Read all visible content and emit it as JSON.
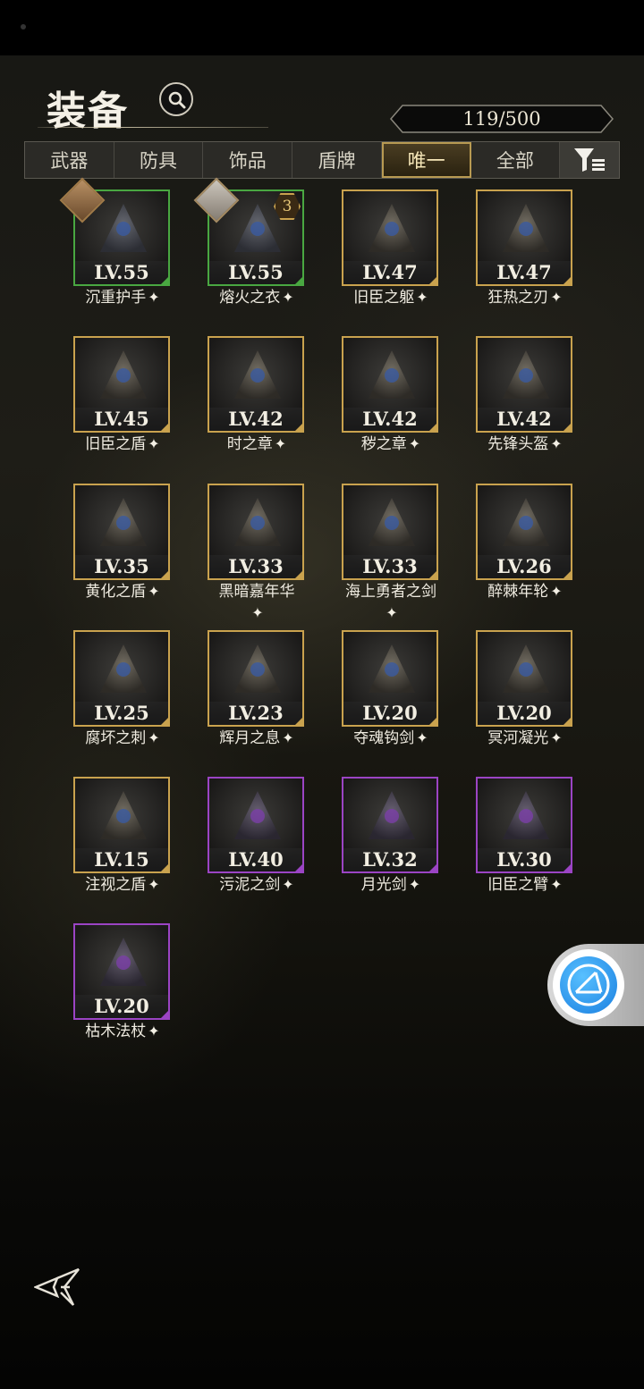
{
  "header": {
    "title": "装备",
    "count": "119/500"
  },
  "tabs": [
    {
      "label": "武器",
      "active": false
    },
    {
      "label": "防具",
      "active": false
    },
    {
      "label": "饰品",
      "active": false
    },
    {
      "label": "盾牌",
      "active": false
    },
    {
      "label": "唯一",
      "active": true
    },
    {
      "label": "全部",
      "active": false
    }
  ],
  "items": [
    {
      "level": "LV.55",
      "name": "沉重护手",
      "rarity": "green",
      "icon": "gauntlet-icon"
    },
    {
      "level": "LV.55",
      "name": "熔火之衣",
      "rarity": "green",
      "icon": "molten-armor-icon",
      "badge": "3"
    },
    {
      "level": "LV.47",
      "name": "旧臣之躯",
      "rarity": "gold",
      "icon": "plate-armor-icon"
    },
    {
      "level": "LV.47",
      "name": "狂热之刃",
      "rarity": "gold",
      "icon": "sword-icon"
    },
    {
      "level": "LV.45",
      "name": "旧臣之盾",
      "rarity": "gold",
      "icon": "tower-shield-icon"
    },
    {
      "level": "LV.42",
      "name": "时之章",
      "rarity": "gold",
      "icon": "tome-icon"
    },
    {
      "level": "LV.42",
      "name": "秽之章",
      "rarity": "gold",
      "icon": "dark-tome-icon"
    },
    {
      "level": "LV.42",
      "name": "先锋头盔",
      "rarity": "gold",
      "icon": "horned-helmet-icon"
    },
    {
      "level": "LV.35",
      "name": "黄化之盾",
      "rarity": "gold",
      "icon": "round-shield-icon"
    },
    {
      "level": "LV.33",
      "name": "黑暗嘉年华",
      "rarity": "gold",
      "icon": "hammer-icon"
    },
    {
      "level": "LV.33",
      "name": "海上勇者之剑",
      "rarity": "gold",
      "icon": "sabre-icon"
    },
    {
      "level": "LV.26",
      "name": "醉棘年轮",
      "rarity": "gold",
      "icon": "wooden-shield-icon"
    },
    {
      "level": "LV.25",
      "name": "腐坏之刺",
      "rarity": "gold",
      "icon": "thorn-staff-icon"
    },
    {
      "level": "LV.23",
      "name": "辉月之息",
      "rarity": "gold",
      "icon": "moon-blade-icon"
    },
    {
      "level": "LV.20",
      "name": "夺魂钩剑",
      "rarity": "gold",
      "icon": "hook-sword-icon"
    },
    {
      "level": "LV.20",
      "name": "冥河凝光",
      "rarity": "gold",
      "icon": "crystal-mace-icon"
    },
    {
      "level": "LV.15",
      "name": "注视之盾",
      "rarity": "gold",
      "icon": "eye-shield-icon"
    },
    {
      "level": "LV.40",
      "name": "污泥之剑",
      "rarity": "purple",
      "icon": "greatsword-icon"
    },
    {
      "level": "LV.32",
      "name": "月光剑",
      "rarity": "purple",
      "icon": "moonlight-sword-icon"
    },
    {
      "level": "LV.30",
      "name": "旧臣之臂",
      "rarity": "purple",
      "icon": "armored-arm-icon"
    },
    {
      "level": "LV.20",
      "name": "枯木法杖",
      "rarity": "purple",
      "icon": "wood-staff-icon"
    }
  ],
  "colors": {
    "gold": "#c9a24e",
    "green": "#49a741",
    "purple": "#9b44c4"
  }
}
